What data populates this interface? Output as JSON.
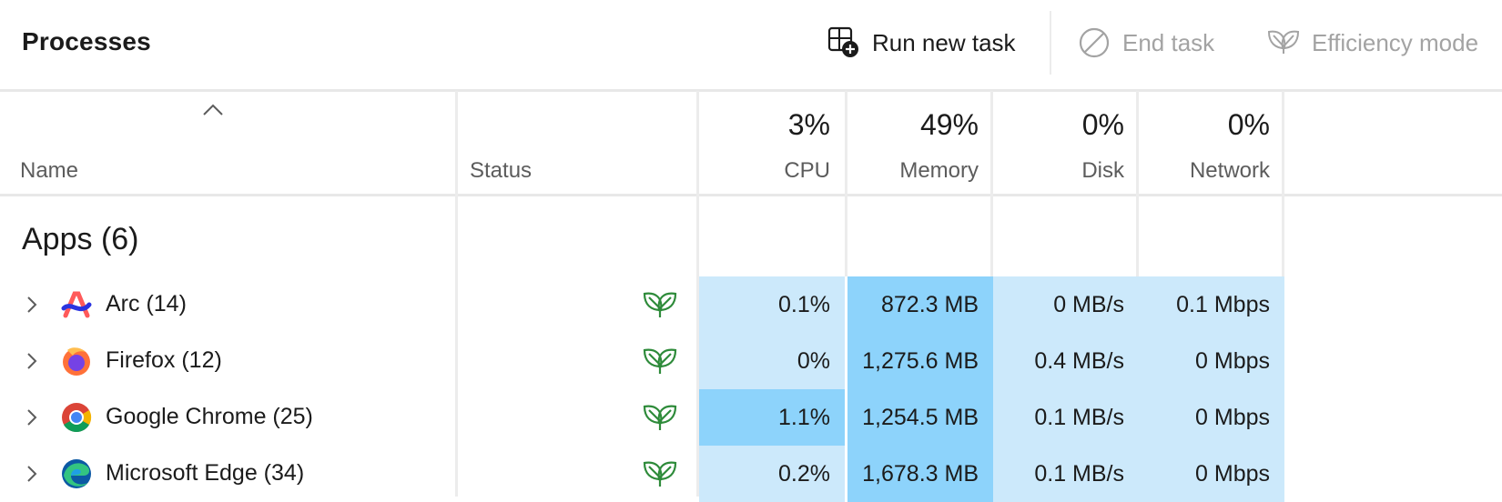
{
  "toolbar": {
    "title": "Processes",
    "run_new_task": "Run new task",
    "end_task": "End task",
    "efficiency_mode": "Efficiency mode"
  },
  "columns": {
    "name": "Name",
    "status": "Status",
    "cpu": {
      "label": "CPU",
      "percent": "3%"
    },
    "memory": {
      "label": "Memory",
      "percent": "49%"
    },
    "disk": {
      "label": "Disk",
      "percent": "0%"
    },
    "network": {
      "label": "Network",
      "percent": "0%"
    }
  },
  "group": {
    "title": "Apps (6)"
  },
  "rows": [
    {
      "name": "Arc (14)",
      "icon": "arc-icon",
      "cpu": "0.1%",
      "memory": "872.3 MB",
      "disk": "0 MB/s",
      "network": "0.1 Mbps",
      "colors": {
        "cpu": "#cce9fb",
        "memory": "#8dd3fb",
        "disk": "#cce9fb",
        "network": "#cce9fb"
      }
    },
    {
      "name": "Firefox (12)",
      "icon": "firefox-icon",
      "cpu": "0%",
      "memory": "1,275.6 MB",
      "disk": "0.4 MB/s",
      "network": "0 Mbps",
      "colors": {
        "cpu": "#cce9fb",
        "memory": "#8dd3fb",
        "disk": "#cce9fb",
        "network": "#cce9fb"
      }
    },
    {
      "name": "Google Chrome (25)",
      "icon": "chrome-icon",
      "cpu": "1.1%",
      "memory": "1,254.5 MB",
      "disk": "0.1 MB/s",
      "network": "0 Mbps",
      "colors": {
        "cpu": "#8dd3fb",
        "memory": "#8dd3fb",
        "disk": "#cce9fb",
        "network": "#cce9fb"
      }
    },
    {
      "name": "Microsoft Edge (34)",
      "icon": "edge-icon",
      "cpu": "0.2%",
      "memory": "1,678.3 MB",
      "disk": "0.1 MB/s",
      "network": "0 Mbps",
      "colors": {
        "cpu": "#cce9fb",
        "memory": "#8dd3fb",
        "disk": "#cce9fb",
        "network": "#cce9fb"
      }
    }
  ],
  "theme": {
    "accent_green": "#2e8b3a",
    "heat_light": "#cce9fb",
    "heat_dark": "#8dd3fb"
  }
}
